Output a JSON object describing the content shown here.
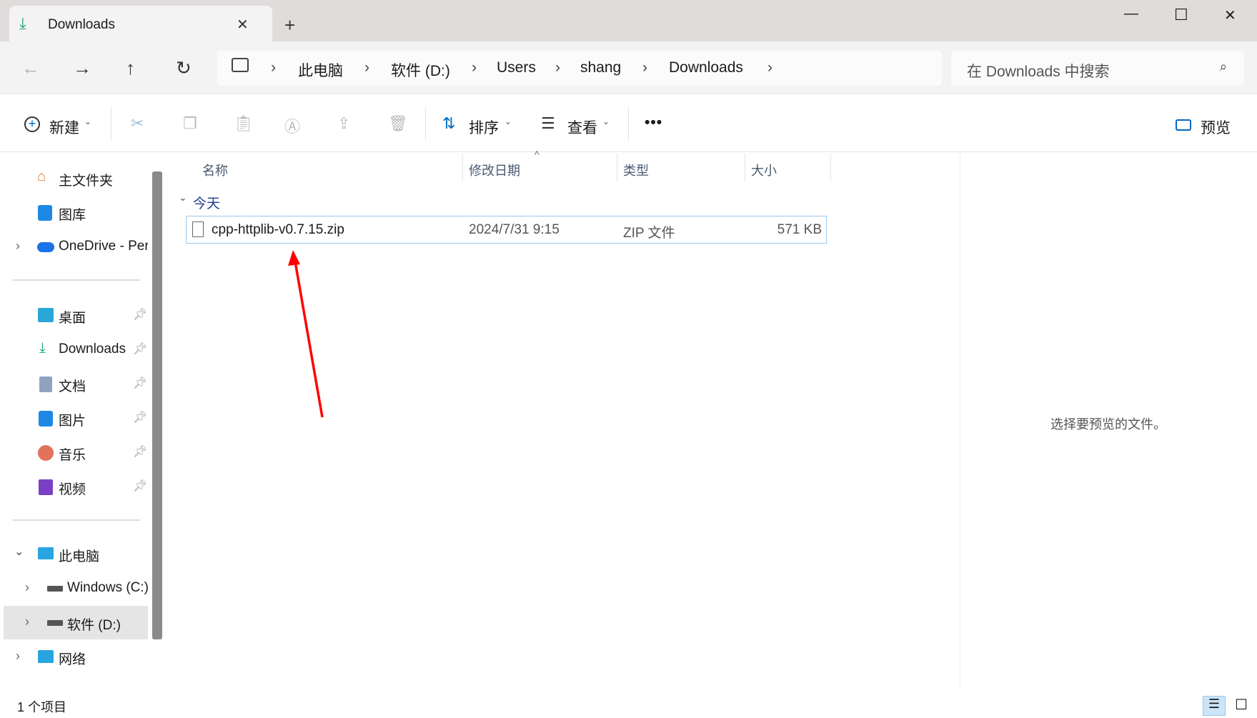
{
  "window": {
    "tab_title": "Downloads",
    "new_tab": "+",
    "controls": {
      "minimize": "—",
      "maximize": "☐",
      "close": "✕"
    }
  },
  "nav": {
    "back": "←",
    "forward": "→",
    "up": "↑",
    "refresh": "↻"
  },
  "breadcrumb": [
    "此电脑",
    "软件 (D:)",
    "Users",
    "shang",
    "Downloads"
  ],
  "search": {
    "placeholder": "在 Downloads 中搜索"
  },
  "toolbar": {
    "new_label": "新建",
    "sort_label": "排序",
    "view_label": "查看",
    "more": "•••",
    "preview_label": "预览"
  },
  "sidebar": {
    "items": [
      {
        "label": "主文件夹",
        "icon": "home-icon"
      },
      {
        "label": "图库",
        "icon": "gallery-icon"
      },
      {
        "label": "OneDrive - Per",
        "icon": "onedrive-icon"
      },
      {
        "label": "桌面",
        "icon": "desktop-icon"
      },
      {
        "label": "Downloads",
        "icon": "download-icon"
      },
      {
        "label": "文档",
        "icon": "documents-icon"
      },
      {
        "label": "图片",
        "icon": "pictures-icon"
      },
      {
        "label": "音乐",
        "icon": "music-icon"
      },
      {
        "label": "视频",
        "icon": "videos-icon"
      },
      {
        "label": "此电脑",
        "icon": "computer-icon"
      },
      {
        "label": "Windows (C:)",
        "icon": "drive-icon"
      },
      {
        "label": "软件 (D:)",
        "icon": "drive-icon"
      },
      {
        "label": "网络",
        "icon": "network-icon"
      }
    ]
  },
  "columns": {
    "name": "名称",
    "date": "修改日期",
    "type": "类型",
    "size": "大小"
  },
  "group": "今天",
  "files": [
    {
      "name": "cpp-httplib-v0.7.15.zip",
      "date": "2024/7/31 9:15",
      "type": "ZIP 文件",
      "size": "571 KB"
    }
  ],
  "preview_text": "选择要预览的文件。",
  "status": {
    "count": "1 个项目"
  },
  "colors": {
    "accent": "#0067c0",
    "selection_border": "#99c9ef",
    "annotation_arrow": "#ff0000"
  }
}
